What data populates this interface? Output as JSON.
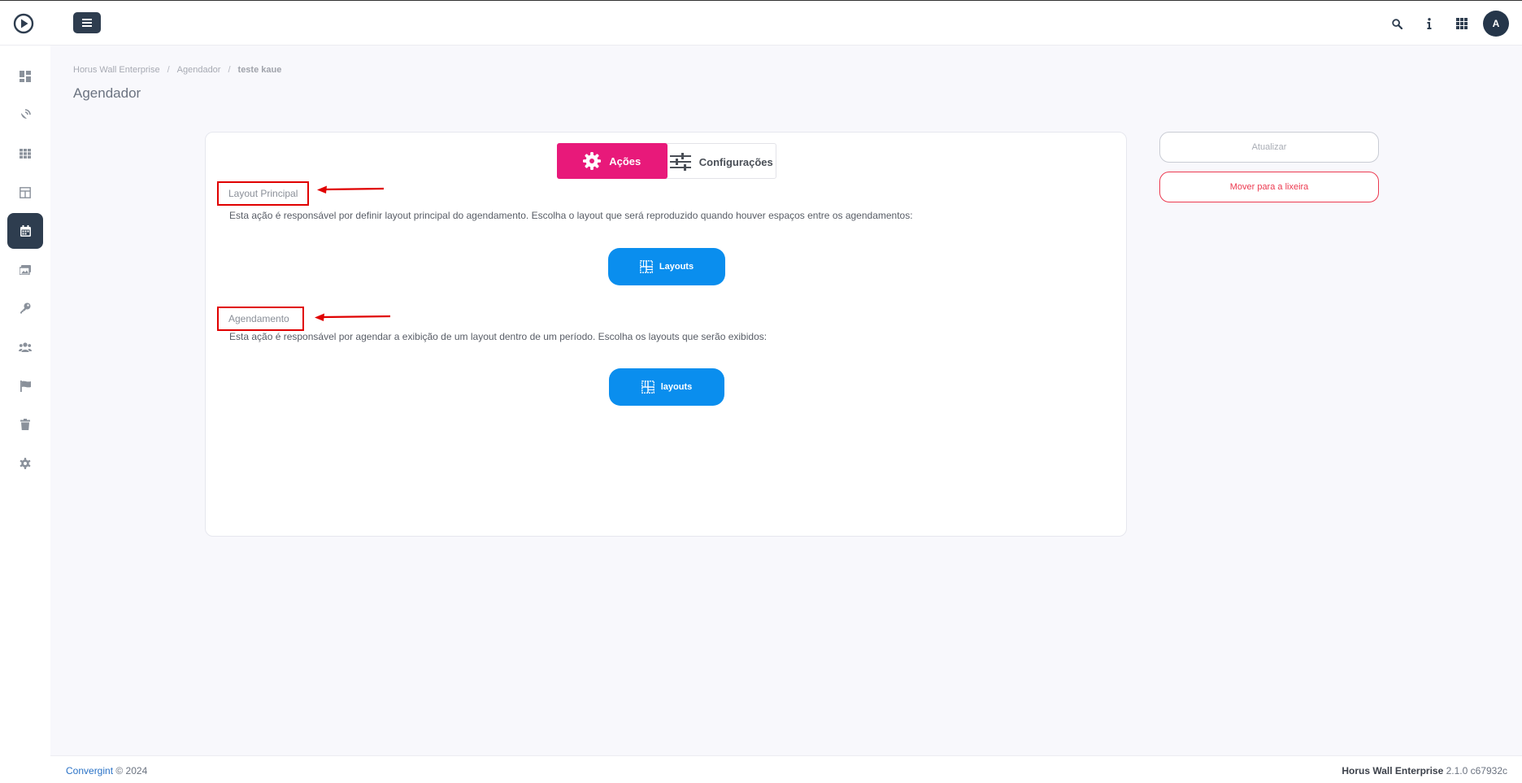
{
  "topbar": {
    "icons": [
      "search-icon",
      "info-icon",
      "apps-grid-icon"
    ],
    "avatar_initial": "A"
  },
  "sidebar": {
    "items": [
      {
        "icon": "dashboard-icon",
        "active": false
      },
      {
        "icon": "satellite-dish-icon",
        "active": false
      },
      {
        "icon": "grid-icon",
        "active": false
      },
      {
        "icon": "layout-icon",
        "active": false
      },
      {
        "icon": "calendar-icon",
        "active": true
      },
      {
        "icon": "images-icon",
        "active": false
      },
      {
        "icon": "key-icon",
        "active": false
      },
      {
        "icon": "users-icon",
        "active": false
      },
      {
        "icon": "flag-icon",
        "active": false
      },
      {
        "icon": "trash-icon",
        "active": false
      },
      {
        "icon": "gear-icon",
        "active": false
      }
    ]
  },
  "breadcrumb": {
    "items": [
      "Horus Wall Enterprise",
      "Agendador",
      "teste kaue"
    ],
    "separator": "/"
  },
  "page_title": "Agendador",
  "tabs": {
    "acoes": "Ações",
    "configuracoes": "Configurações"
  },
  "sections": {
    "layout_principal": {
      "label": "Layout Principal",
      "description": "Esta ação é responsável por definir layout principal do agendamento. Escolha o layout que será reproduzido quando houver espaços entre os agendamentos:",
      "button": "Layouts"
    },
    "agendamento": {
      "label": "Agendamento",
      "description": "Esta ação é responsável por agendar a exibição de um layout dentro de um período. Escolha os layouts que serão exibidos:",
      "button": "layouts"
    }
  },
  "actions": {
    "update": "Atualizar",
    "move_to_trash": "Mover para a lixeira"
  },
  "footer": {
    "brand": "Convergint",
    "copyright": "© 2024",
    "product": "Horus Wall Enterprise",
    "version": "2.1.0 c67932c"
  },
  "colors": {
    "accent": "#e8197a",
    "primary_button": "#0a8eee",
    "dark": "#2e3d4f",
    "danger": "#ec3a50",
    "annotation": "#e00000"
  }
}
